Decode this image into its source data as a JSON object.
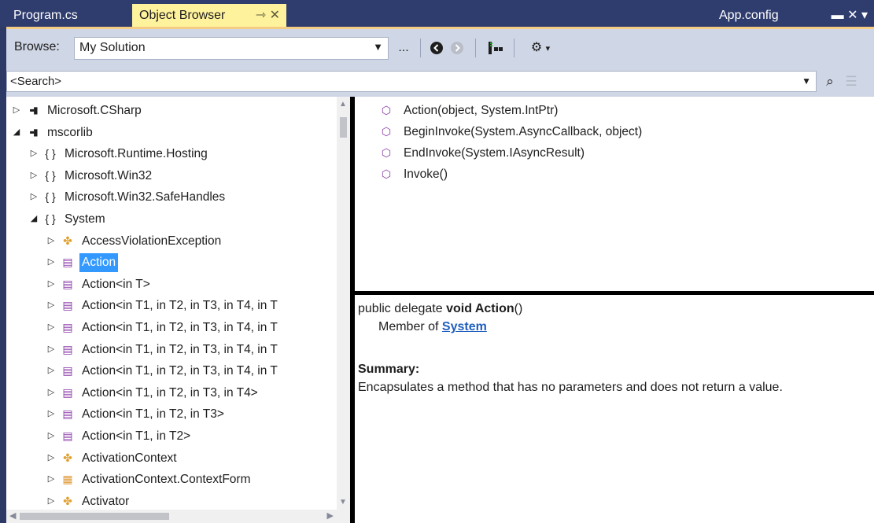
{
  "tabs": [
    {
      "label": "Program.cs",
      "active": false
    },
    {
      "label": "Object Browser",
      "active": true,
      "icons": "⇾ ✕"
    },
    {
      "label": "App.config",
      "active": false,
      "icons": "▬ ✕ ▾"
    }
  ],
  "toolbar": {
    "browse_label": "Browse:",
    "browse_value": "My Solution",
    "ellipsis": "..."
  },
  "search": {
    "value": "<Search>"
  },
  "tree": [
    {
      "level": 0,
      "expander": "▷",
      "icon": "assembly-icon",
      "label": "Microsoft.CSharp"
    },
    {
      "level": 0,
      "expander": "◢",
      "icon": "assembly-icon",
      "label": "mscorlib"
    },
    {
      "level": 1,
      "expander": "▷",
      "icon": "namespace-icon",
      "label": "Microsoft.Runtime.Hosting"
    },
    {
      "level": 1,
      "expander": "▷",
      "icon": "namespace-icon",
      "label": "Microsoft.Win32"
    },
    {
      "level": 1,
      "expander": "▷",
      "icon": "namespace-icon",
      "label": "Microsoft.Win32.SafeHandles"
    },
    {
      "level": 1,
      "expander": "◢",
      "icon": "namespace-icon",
      "label": "System"
    },
    {
      "level": 2,
      "expander": "▷",
      "icon": "class-icon",
      "label": "AccessViolationException"
    },
    {
      "level": 2,
      "expander": "▷",
      "icon": "delegate-icon",
      "label": "Action",
      "selected": true
    },
    {
      "level": 2,
      "expander": "▷",
      "icon": "delegate-icon",
      "label": "Action<in T>"
    },
    {
      "level": 2,
      "expander": "▷",
      "icon": "delegate-icon",
      "label": "Action<in T1, in T2, in T3, in T4, in T"
    },
    {
      "level": 2,
      "expander": "▷",
      "icon": "delegate-icon",
      "label": "Action<in T1, in T2, in T3, in T4, in T"
    },
    {
      "level": 2,
      "expander": "▷",
      "icon": "delegate-icon",
      "label": "Action<in T1, in T2, in T3, in T4, in T"
    },
    {
      "level": 2,
      "expander": "▷",
      "icon": "delegate-icon",
      "label": "Action<in T1, in T2, in T3, in T4, in T"
    },
    {
      "level": 2,
      "expander": "▷",
      "icon": "delegate-icon",
      "label": "Action<in T1, in T2, in T3, in T4>"
    },
    {
      "level": 2,
      "expander": "▷",
      "icon": "delegate-icon",
      "label": "Action<in T1, in T2, in T3>"
    },
    {
      "level": 2,
      "expander": "▷",
      "icon": "delegate-icon",
      "label": "Action<in T1, in T2>"
    },
    {
      "level": 2,
      "expander": "▷",
      "icon": "class-icon",
      "label": "ActivationContext"
    },
    {
      "level": 2,
      "expander": "▷",
      "icon": "enum-icon",
      "label": "ActivationContext.ContextForm"
    },
    {
      "level": 2,
      "expander": "▷",
      "icon": "class-icon",
      "label": "Activator"
    }
  ],
  "members": [
    {
      "icon": "method-icon",
      "label": "Action(object, System.IntPtr)"
    },
    {
      "icon": "method-icon",
      "label": "BeginInvoke(System.AsyncCallback, object)"
    },
    {
      "icon": "method-icon",
      "label": "EndInvoke(System.IAsyncResult)"
    },
    {
      "icon": "method-icon",
      "label": "Invoke()"
    }
  ],
  "description": {
    "sig_prefix": "public delegate ",
    "sig_bold": "void Action",
    "sig_suffix": "()",
    "member_of": "Member of ",
    "member_link": "System",
    "summary_heading": "Summary:",
    "summary_text": "Encapsulates a method that has no parameters and does not return a value."
  },
  "colors": {
    "tab_strip": "#2f3c6e",
    "active_tab": "#fff29d",
    "selection": "#3399ff",
    "delegate_icon": "#8a3aa6",
    "class_icon": "#e0a030",
    "link": "#1f5fbf"
  }
}
